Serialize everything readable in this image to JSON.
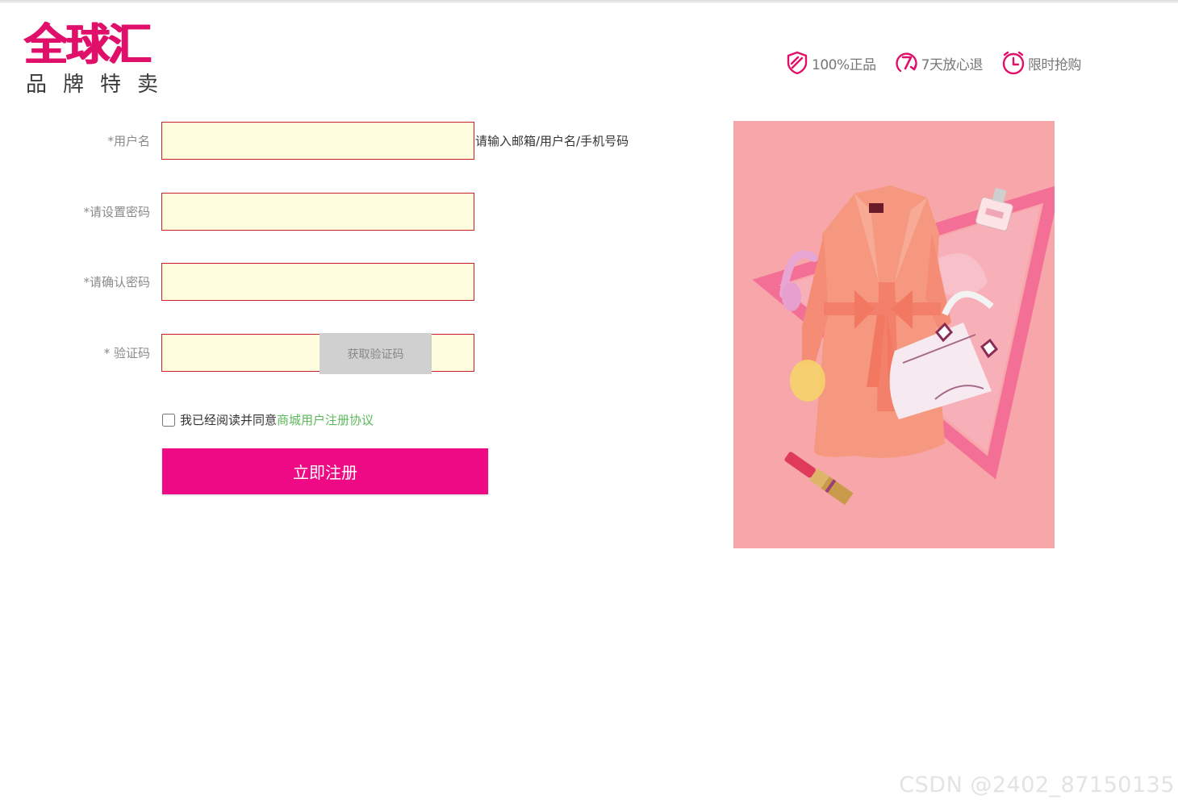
{
  "logo": {
    "main": "全球汇",
    "sub": "品牌特卖"
  },
  "badges": [
    {
      "icon": "shield-check-icon",
      "label": "100%正品"
    },
    {
      "icon": "seven-day-return-icon",
      "label": "7天放心退"
    },
    {
      "icon": "clock-icon",
      "label": "限时抢购"
    }
  ],
  "form": {
    "username_label": "*用户名",
    "username_hint": "请输入邮箱/用户名/手机号码",
    "password_label": "*请设置密码",
    "confirm_label": "*请确认密码",
    "captcha_label": "* 验证码",
    "get_code_label": "获取验证码",
    "agree_text": "我已经阅读并同意",
    "agree_link": "商城用户注册协议",
    "submit_label": "立即注册"
  },
  "colors": {
    "brand": "#e0106a",
    "button": "#ee0a84",
    "input_bg": "#ffffe0",
    "input_border": "#c8202a",
    "link": "#5cb85c",
    "banner_bg": "#f7a6a9"
  },
  "watermark": "CSDN @2402_87150135"
}
